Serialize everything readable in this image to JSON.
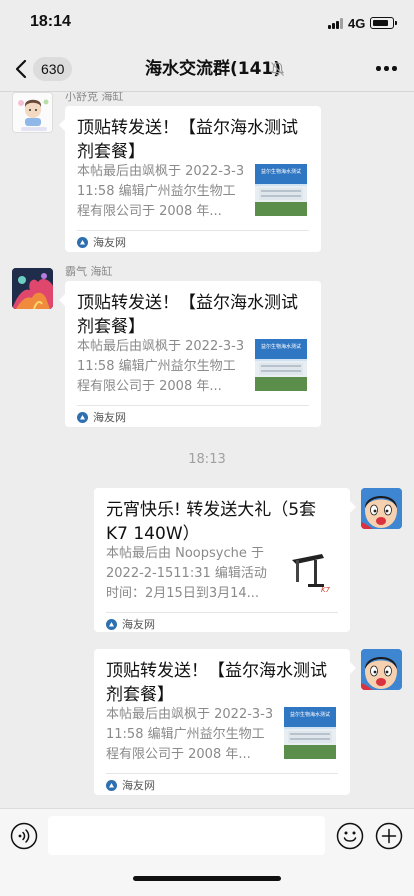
{
  "status_bar": {
    "time": "18:14",
    "network": "4G"
  },
  "nav": {
    "unread_count": "630",
    "title": "海水交流群(141)"
  },
  "messages": [
    {
      "sender": "小舒克 海缸",
      "title": "顶贴转发送！【益尔海水测试剂套餐】",
      "desc": "本帖最后由飒枫于 2022-3-311:58 编辑广州益尔生物工程有限公司于 2008 年...",
      "source": "海友网",
      "thumb_text": "益尔生物海水测试"
    },
    {
      "sender": "霸气 海缸",
      "title": "顶贴转发送！【益尔海水测试剂套餐】",
      "desc": "本帖最后由飒枫于 2022-3-311:58 编辑广州益尔生物工程有限公司于 2008 年...",
      "source": "海友网",
      "thumb_text": "益尔生物海水测试"
    },
    {
      "time": "18:13"
    },
    {
      "title": "元宵快乐! 转发送大礼（5套 K7  140W）",
      "desc": "本帖最后由 Noopsyche 于 2022-2-1511:31 编辑活动时间：2月15日到3月14...",
      "source": "海友网",
      "thumb_text": "K7"
    },
    {
      "title": "顶贴转发送！【益尔海水测试剂套餐】",
      "desc": "本帖最后由飒枫于 2022-3-311:58 编辑广州益尔生物工程有限公司于 2008 年...",
      "source": "海友网",
      "thumb_text": "益尔生物海水测试"
    }
  ],
  "colors": {
    "background": "#ededed",
    "card": "#ffffff",
    "muted_text": "#8a8a8a",
    "source_icon": "#2e6fb0"
  },
  "icons": [
    "back-icon",
    "mute-icon",
    "more-icon",
    "voice-icon",
    "emoji-icon",
    "plus-icon",
    "source-icon"
  ]
}
